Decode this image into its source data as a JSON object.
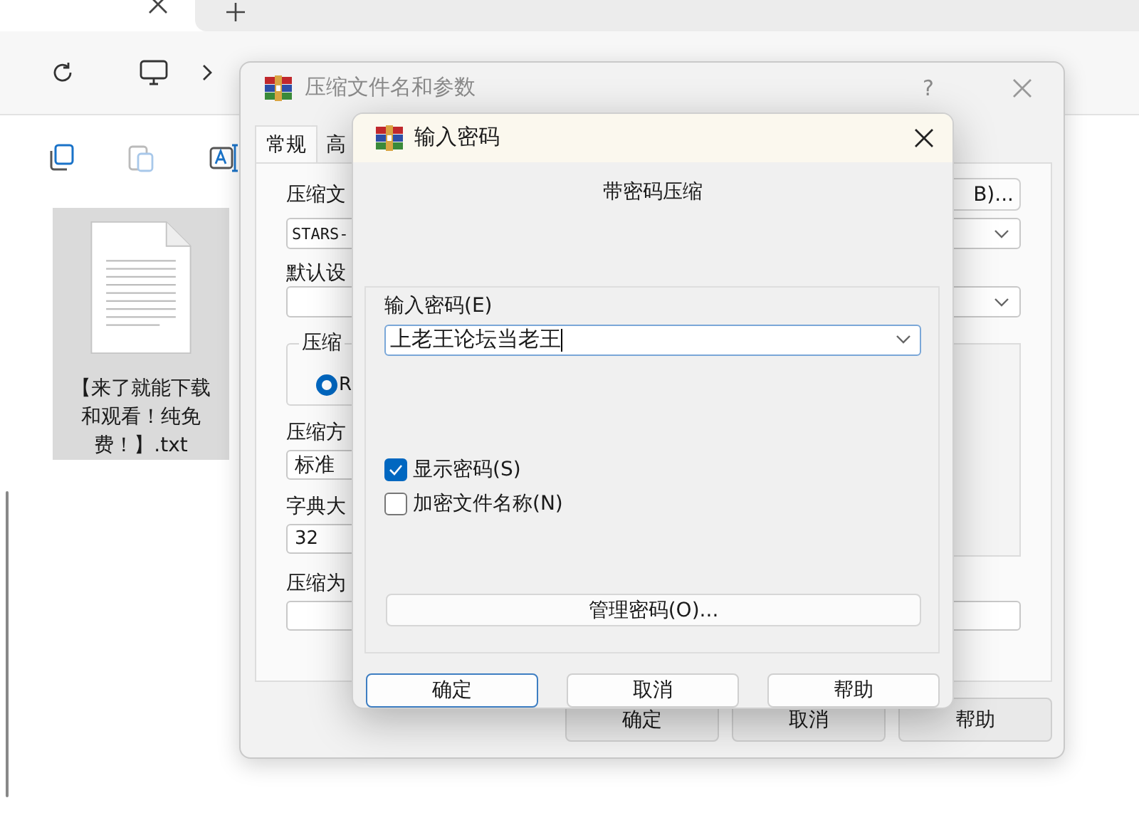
{
  "explorer": {
    "files": [
      {
        "name": "【来了就能下载和观看！纯免费！】.txt",
        "selected": true
      }
    ]
  },
  "archive_dialog": {
    "title": "压缩文件名和参数",
    "help": "?",
    "tabs": [
      {
        "label": "常规",
        "selected": true
      },
      {
        "label": "高",
        "selected": false
      }
    ],
    "archive_name_label": "压缩文",
    "browse_button": "B)...",
    "archive_name": "STARS-",
    "profile_label": "默认设",
    "format_group": "压缩",
    "format_options": [
      {
        "label": "R",
        "selected": true
      }
    ],
    "method_label": "压缩方",
    "method": "标准",
    "dictionary_label": "字典大",
    "dictionary": "32",
    "split_label": "压缩为",
    "buttons": [
      "确定",
      "取消",
      "帮助"
    ]
  },
  "password_dialog": {
    "title": "输入密码",
    "heading": "带密码压缩",
    "password_label": "输入密码(E)",
    "password": "上老王论坛当老王",
    "options": [
      {
        "label": "显示密码(S)",
        "checked": true
      },
      {
        "label": "加密文件名称(N)",
        "checked": false
      }
    ],
    "manage_button": "管理密码(O)...",
    "buttons": [
      {
        "label": "确定",
        "default": true
      },
      {
        "label": "取消",
        "default": false
      },
      {
        "label": "帮助",
        "default": false
      }
    ]
  }
}
